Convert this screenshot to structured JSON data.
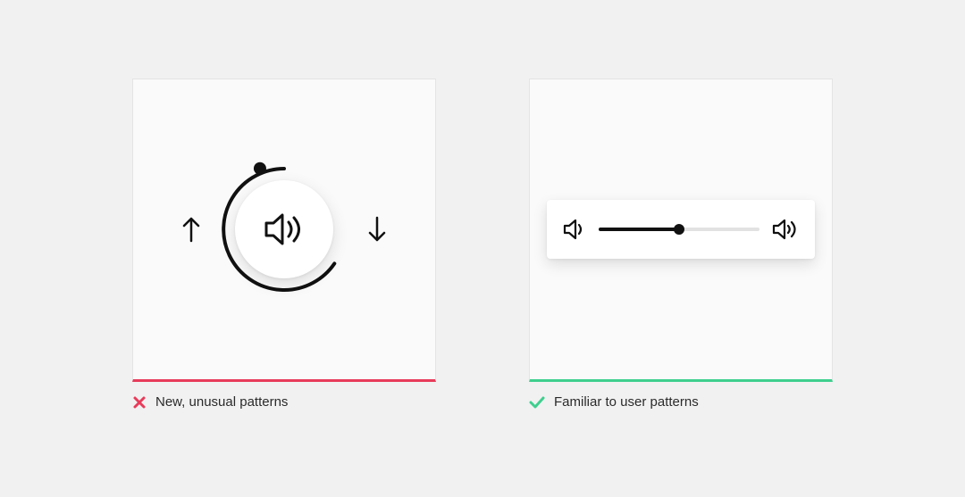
{
  "bad": {
    "caption": "New, unusual patterns",
    "status_color": "#e83b5a",
    "accent_border": "#e83b5a"
  },
  "good": {
    "caption": "Familiar to user patterns",
    "status_color": "#3ecf8e",
    "accent_border": "#3ecf8e",
    "slider_value_percent": 50
  }
}
